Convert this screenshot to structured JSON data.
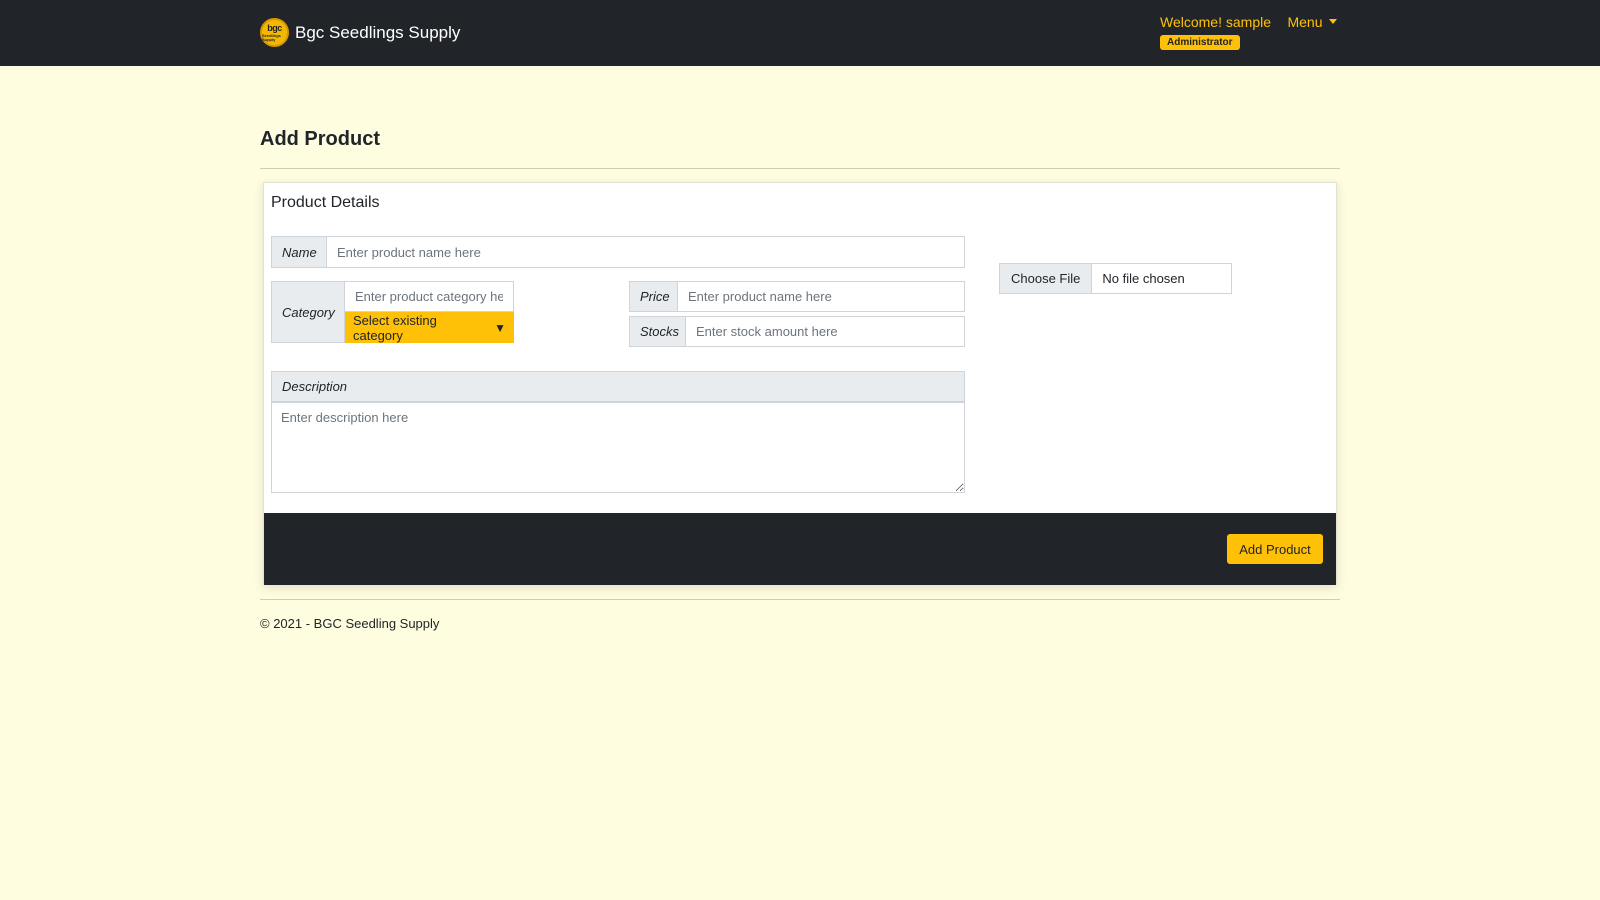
{
  "navbar": {
    "brand": "Bgc Seedlings Supply",
    "logo_text": "bgc",
    "logo_subtext": "Seedlings Supply",
    "welcome": "Welcome! sample",
    "menu_label": "Menu",
    "role_badge": "Administrator"
  },
  "page": {
    "title": "Add Product"
  },
  "form": {
    "section_title": "Product Details",
    "name_label": "Name",
    "name_placeholder": "Enter product name here",
    "category_label": "Category",
    "category_placeholder": "Enter product category here",
    "select_existing_label": "Select existing category",
    "select_existing_icon": "▼",
    "price_label": "Price",
    "price_placeholder": "Enter product name here",
    "stocks_label": "Stocks",
    "stocks_placeholder": "Enter stock amount here",
    "description_label": "Description",
    "description_placeholder": "Enter description here",
    "choose_file_label": "Choose File",
    "file_status": "No file chosen",
    "submit_label": "Add Product"
  },
  "footer": {
    "copyright": "© 2021 - BGC Seedling Supply"
  },
  "colors": {
    "page_bg": "#fffde0",
    "navbar_bg": "#212529",
    "accent": "#ffc107"
  }
}
